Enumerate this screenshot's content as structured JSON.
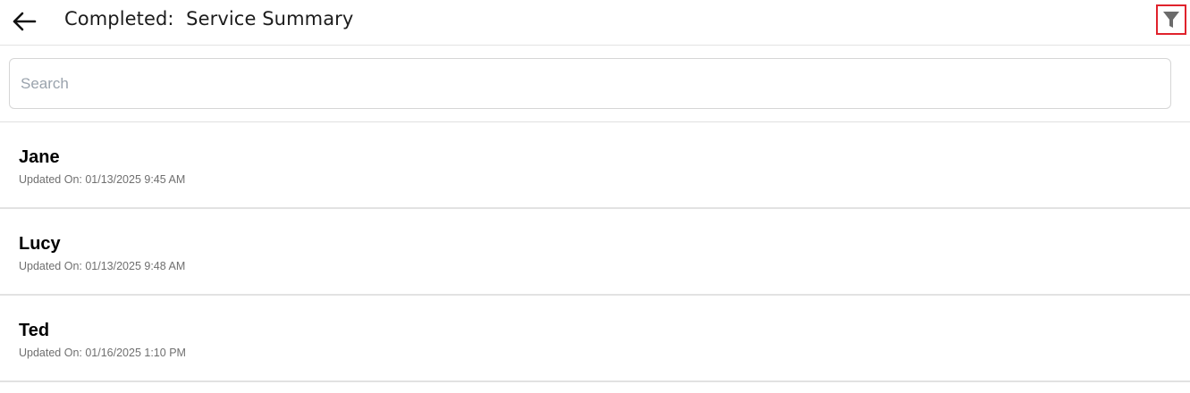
{
  "header": {
    "title": "Completed:  Service Summary",
    "back_icon": "arrow-left-icon",
    "filter_icon": "filter-funnel-icon",
    "filter_highlight_color": "#e0222c"
  },
  "search": {
    "placeholder": "Search",
    "value": ""
  },
  "records": [
    {
      "name": "Jane",
      "updated": "Updated On: 01/13/2025 9:45 AM"
    },
    {
      "name": "Lucy",
      "updated": "Updated On: 01/13/2025 9:48 AM"
    },
    {
      "name": "Ted",
      "updated": "Updated On: 01/16/2025 1:10 PM"
    }
  ]
}
